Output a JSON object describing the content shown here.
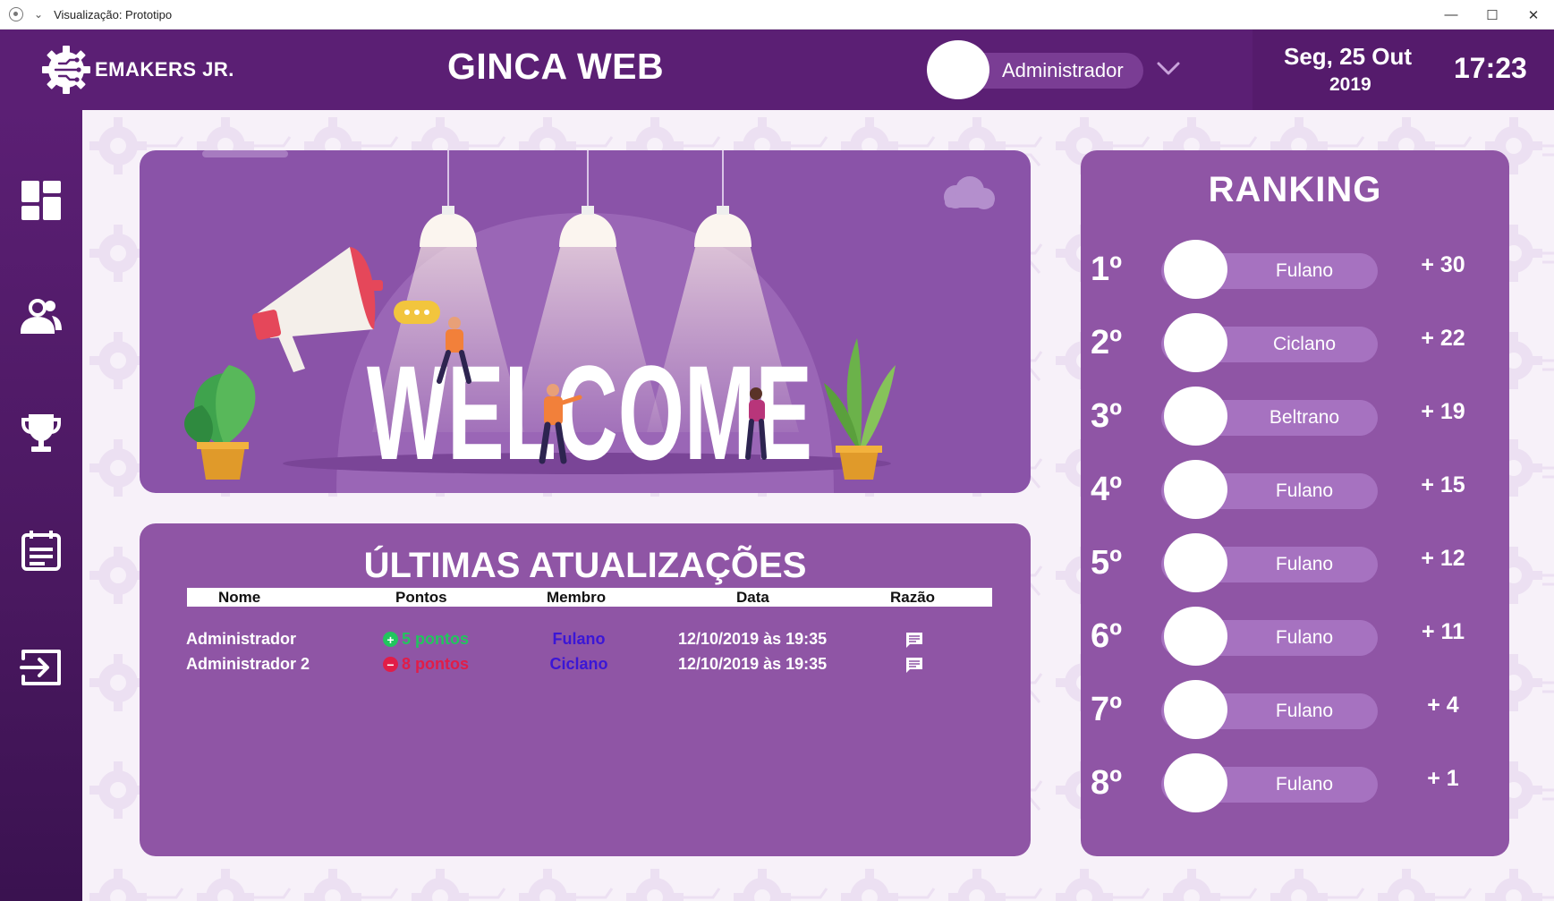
{
  "window": {
    "title": "Visualização: Prototipo",
    "minimize": "—",
    "maximize": "☐",
    "close": "✕"
  },
  "header": {
    "logo_text": "EMAKERS JR.",
    "app_title": "GINCA WEB",
    "user_name": "Administrador",
    "date_day": "Seg, 25 Out",
    "date_year": "2019",
    "time": "17:23"
  },
  "sidebar": {
    "items": [
      {
        "icon": "dashboard-icon"
      },
      {
        "icon": "users-icon"
      },
      {
        "icon": "trophy-icon"
      },
      {
        "icon": "calendar-icon"
      },
      {
        "icon": "logout-icon"
      }
    ]
  },
  "welcome": {
    "text": "WELCOME"
  },
  "updates": {
    "title": "ÚLTIMAS ATUALIZAÇÕES",
    "columns": [
      "Nome",
      "Pontos",
      "Membro",
      "Data",
      "Razão"
    ],
    "rows": [
      {
        "nome": "Administrador",
        "sign": "+",
        "pontos": "5 pontos",
        "membro": "Fulano",
        "data": "12/10/2019  às 19:35"
      },
      {
        "nome": "Administrador 2",
        "sign": "−",
        "pontos": "8 pontos",
        "membro": "Ciclano",
        "data": "12/10/2019  às 19:35"
      }
    ]
  },
  "ranking": {
    "title": "RANKING",
    "entries": [
      {
        "pos": "1º",
        "name": "Fulano",
        "score": "+ 30"
      },
      {
        "pos": "2º",
        "name": "Ciclano",
        "score": "+ 22"
      },
      {
        "pos": "3º",
        "name": "Beltrano",
        "score": "+ 19"
      },
      {
        "pos": "4º",
        "name": "Fulano",
        "score": "+ 15"
      },
      {
        "pos": "5º",
        "name": "Fulano",
        "score": "+ 12"
      },
      {
        "pos": "6º",
        "name": "Fulano",
        "score": "+ 11"
      },
      {
        "pos": "7º",
        "name": "Fulano",
        "score": "+ 4"
      },
      {
        "pos": "8º",
        "name": "Fulano",
        "score": "+ 1"
      }
    ]
  },
  "colors": {
    "header": "#5b1f74",
    "panel": "#8f55a5",
    "positive": "#22c55e",
    "negative": "#e11d48",
    "member": "#3b16d6"
  }
}
